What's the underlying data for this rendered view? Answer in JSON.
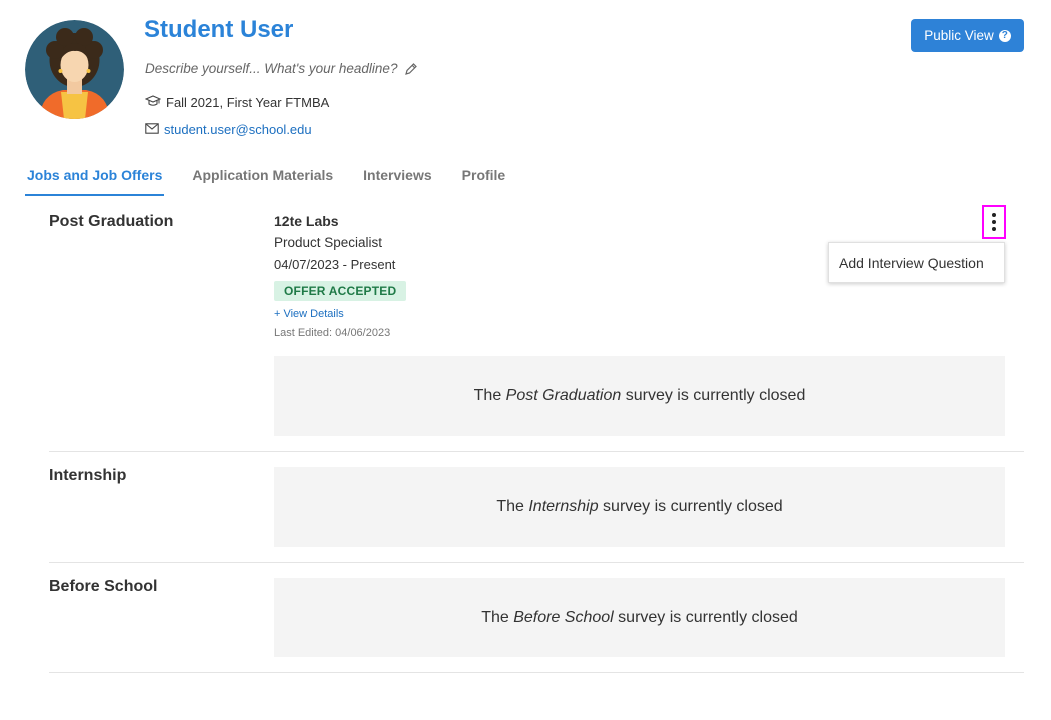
{
  "profile": {
    "name": "Student User",
    "headline_placeholder": "Describe yourself... What's your headline?",
    "cohort": "Fall 2021, First Year FTMBA",
    "email": "student.user@school.edu"
  },
  "header": {
    "public_view_label": "Public View",
    "public_view_help_icon": "?"
  },
  "tabs": [
    {
      "label": "Jobs and Job Offers",
      "active": true
    },
    {
      "label": "Application Materials",
      "active": false
    },
    {
      "label": "Interviews",
      "active": false
    },
    {
      "label": "Profile",
      "active": false
    }
  ],
  "sections": {
    "post_graduation": {
      "title": "Post Graduation",
      "job": {
        "company": "12te Labs",
        "title": "Product Specialist",
        "dates": "04/07/2023 - Present",
        "status": "OFFER ACCEPTED",
        "view_details": "+ View Details",
        "last_edited": "Last Edited: 04/06/2023"
      },
      "survey": {
        "prefix": "The ",
        "name": "Post Graduation",
        "suffix": " survey is currently closed"
      }
    },
    "internship": {
      "title": "Internship",
      "survey": {
        "prefix": "The ",
        "name": "Internship",
        "suffix": " survey is currently closed"
      }
    },
    "before_school": {
      "title": "Before School",
      "survey": {
        "prefix": "The ",
        "name": "Before School",
        "suffix": " survey is currently closed"
      }
    }
  },
  "menu": {
    "items": [
      {
        "label": "Add Interview Question"
      }
    ]
  },
  "colors": {
    "accent": "#2b83d8",
    "button": "#2e82d7",
    "badge_bg": "#d8f2e4",
    "badge_text": "#1f7a47",
    "highlight": "#ff00ff"
  },
  "icons": {
    "edit": "pencil-icon",
    "cohort": "graduation-cap-icon",
    "email": "envelope-icon",
    "help": "question-circle-icon",
    "more": "kebab-menu-icon"
  }
}
